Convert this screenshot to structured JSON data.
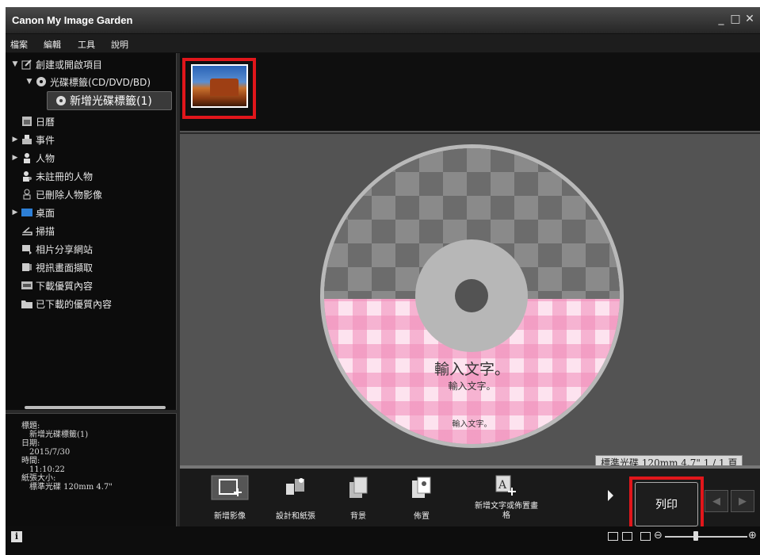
{
  "app": {
    "title": "Canon My Image Garden"
  },
  "window_controls": {
    "minimize": "_",
    "maximize": "□",
    "close": "✕"
  },
  "menu": [
    "檔案",
    "編輯",
    "工具",
    "說明"
  ],
  "sidebar": {
    "items": [
      {
        "label": "創建或開啟項目",
        "icon": "create-project-icon",
        "arrow": "▼"
      },
      {
        "label": "光碟標籤(CD/DVD/BD)",
        "icon": "disc-icon",
        "arrow": "▼"
      },
      {
        "label": "新增光碟標籤(1)",
        "icon": "disc-icon"
      },
      {
        "label": "日曆",
        "icon": "calendar-icon"
      },
      {
        "label": "事件",
        "icon": "event-icon",
        "arrow": "▶"
      },
      {
        "label": "人物",
        "icon": "person-icon",
        "arrow": "▶"
      },
      {
        "label": "未註冊的人物",
        "icon": "unregistered-person-icon"
      },
      {
        "label": "已刪除人物影像",
        "icon": "deleted-person-icon"
      },
      {
        "label": "桌面",
        "icon": "desktop-icon",
        "arrow": "▶"
      },
      {
        "label": "掃描",
        "icon": "scan-icon"
      },
      {
        "label": "相片分享網站",
        "icon": "photo-sharing-icon"
      },
      {
        "label": "視訊畫面擷取",
        "icon": "video-capture-icon"
      },
      {
        "label": "下載優質內容",
        "icon": "download-content-icon"
      },
      {
        "label": "已下載的優質內容",
        "icon": "folder-icon"
      }
    ]
  },
  "info_panel": {
    "title_label": "標題:",
    "title_value": "新增光碟標籤(1)",
    "date_label": "日期:",
    "date_value": "2015/7/30",
    "time_label": "時間:",
    "time_value": "11:10:22",
    "paper_size_label": "紙張大小:",
    "paper_size_value": "標準光碟 120mm 4.7\""
  },
  "disc": {
    "text_large": "輸入文字。",
    "text_medium": "輸入文字。",
    "text_small": "輸入文字。"
  },
  "size_label": "標準光碟 120mm 4.7\" 1 / 1 頁",
  "toolbar": {
    "add_image": "新增影像",
    "design_paper": "設計和紙張",
    "background": "背景",
    "layout": "佈置",
    "add_text": "新增文字或佈置畫格",
    "print": "列印"
  },
  "statusbar": {
    "info": "i",
    "zoom_minus": "⊖",
    "zoom_plus": "⊕",
    "zoom_level": 0.38
  },
  "colors": {
    "highlight": "#e1161b",
    "background": "#2a2a2a"
  }
}
